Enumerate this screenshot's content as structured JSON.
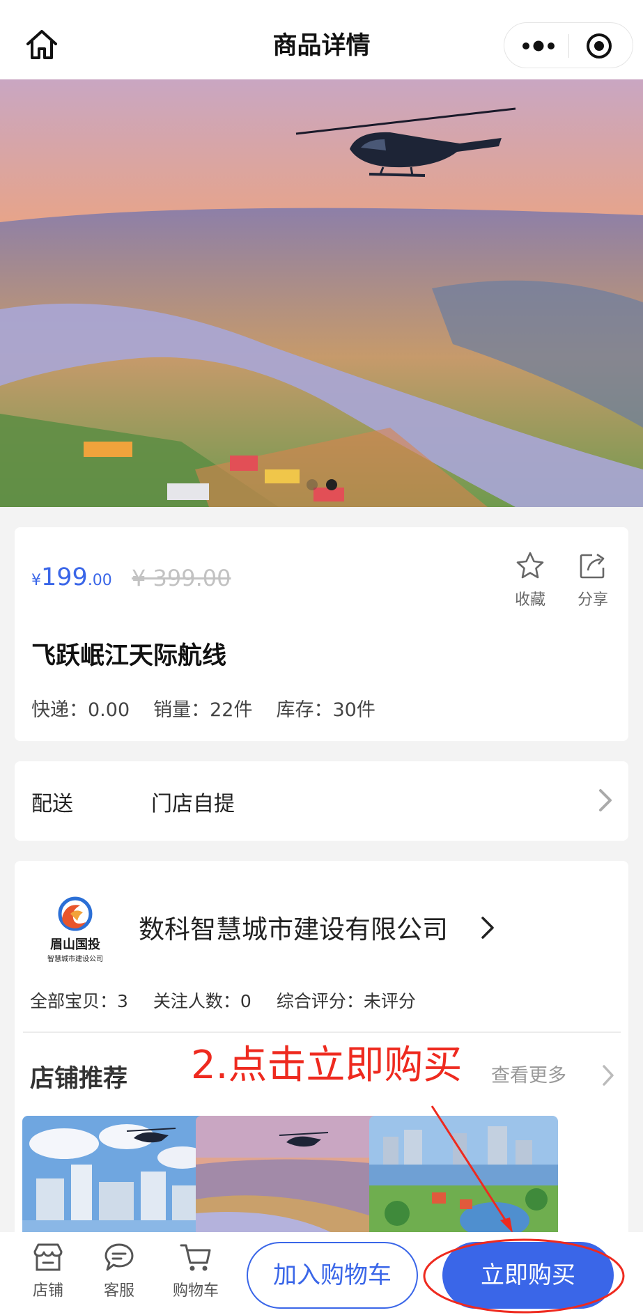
{
  "header": {
    "title": "商品详情",
    "home_icon": "home-icon",
    "more_icon": "more-dots-icon",
    "target_icon": "target-icon"
  },
  "hero": {
    "slide_count": 2,
    "active_slide": 2
  },
  "product": {
    "price_symbol": "¥",
    "price_integer": "199",
    "price_decimal": ".00",
    "original_price": "¥ 399.00",
    "favorite_label": "收藏",
    "share_label": "分享",
    "title": "飞跃岷江天际航线",
    "shipping": "快递：0.00",
    "sales": "销量：22件",
    "stock": "库存：30件"
  },
  "delivery": {
    "label": "配送",
    "value": "门店自提"
  },
  "shop": {
    "logo_text_main": "眉山国投",
    "logo_text_sub": "智慧城市建设公司",
    "name": "数科智慧城市建设有限公司",
    "total_items": "全部宝贝：3",
    "followers": "关注人数：0",
    "rating": "综合评分：未评分",
    "recommend_title": "店铺推荐",
    "view_more": "查看更多"
  },
  "annotation": {
    "text": "2.点击立即购买",
    "color": "#ee2a1f"
  },
  "bottom_bar": {
    "store_label": "店铺",
    "service_label": "客服",
    "cart_tab_label": "购物车",
    "add_to_cart": "加入购物车",
    "buy_now": "立即购买"
  },
  "colors": {
    "accent": "#3a66e8",
    "annotation_red": "#ee2a1f"
  }
}
